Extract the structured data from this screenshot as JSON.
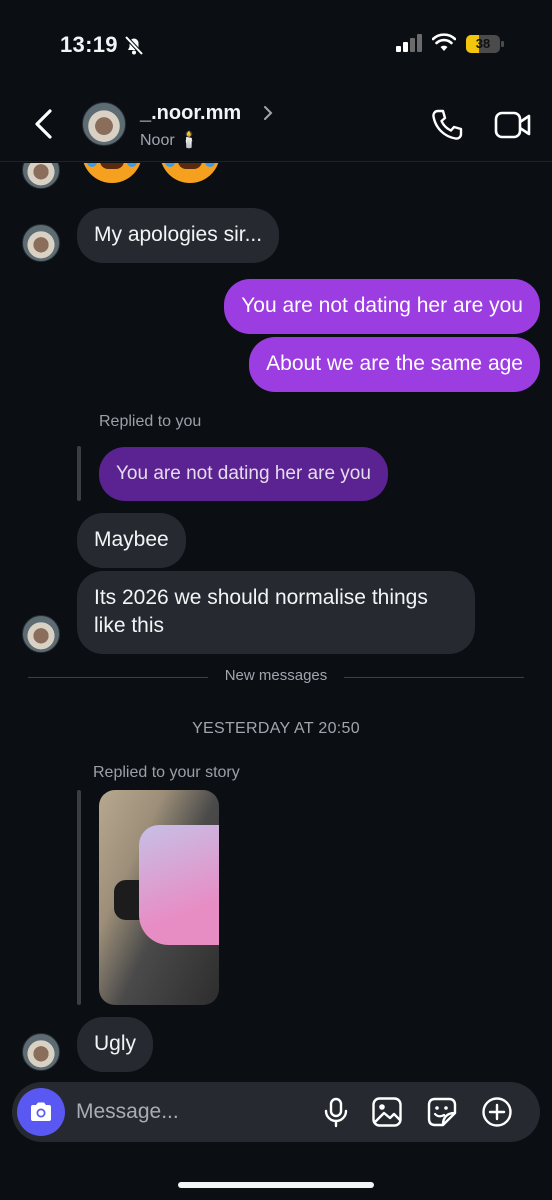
{
  "status": {
    "time": "13:19",
    "battery": "38",
    "battery_level": 0.38
  },
  "header": {
    "username": "_.noor.mm",
    "subname": "Noor 🕯️"
  },
  "messages": {
    "m1": "My apologies sir...",
    "m2": "You are not dating her are you",
    "m3": "About we are the same age",
    "reply_caption": "Replied to you",
    "quoted": "You are not dating her are you",
    "m4": "Maybee",
    "m5_line1": "Its 2026 we should normalise things",
    "m5_line2": "like this",
    "new_messages": "New messages",
    "date": "YESTERDAY AT 20:50",
    "story_caption": "Replied to your story",
    "m6": "Ugly"
  },
  "composer": {
    "placeholder": "Message..."
  },
  "colors": {
    "sent": "#9b3de0",
    "received": "#262a30",
    "quoted": "#5b2391",
    "camera": "#5a58f2"
  },
  "icons": [
    "back-chevron-icon",
    "phone-icon",
    "video-camera-icon",
    "camera-icon",
    "microphone-icon",
    "gallery-icon",
    "sticker-icon",
    "plus-circle-icon"
  ]
}
